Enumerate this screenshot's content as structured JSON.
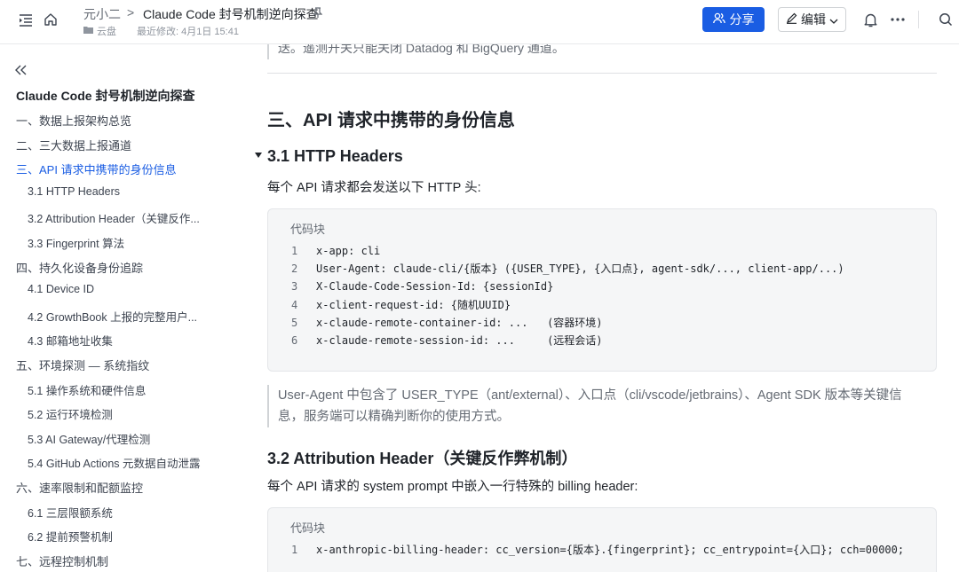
{
  "header": {
    "breadcrumb_parent": "元小二",
    "breadcrumb_sep": ">",
    "title": "Claude Code 封号机制逆向探查",
    "location": "云盘",
    "last_modified": "最近修改: 4月1日 15:41",
    "share_label": "分享",
    "edit_label": "编辑"
  },
  "sidebar": {
    "doc_title": "Claude Code 封号机制逆向探查",
    "items": [
      {
        "label": "一、数据上报架构总览",
        "level": 1
      },
      {
        "label": "二、三大数据上报通道",
        "level": 1
      },
      {
        "label": "三、API 请求中携带的身份信息",
        "level": 1,
        "active": true
      },
      {
        "label": "3.1 HTTP Headers",
        "level": 2
      },
      {
        "label": "3.2 Attribution Header（关键反作...",
        "level": 2
      },
      {
        "label": "3.3 Fingerprint 算法",
        "level": 2
      },
      {
        "label": "四、持久化设备身份追踪",
        "level": 1
      },
      {
        "label": "4.1 Device ID",
        "level": 2
      },
      {
        "label": "4.2 GrowthBook 上报的完整用户...",
        "level": 2
      },
      {
        "label": "4.3 邮箱地址收集",
        "level": 2
      },
      {
        "label": "五、环境探测 — 系统指纹",
        "level": 1
      },
      {
        "label": "5.1 操作系统和硬件信息",
        "level": 2
      },
      {
        "label": "5.2 运行环境检测",
        "level": 2
      },
      {
        "label": "5.3 AI Gateway/代理检测",
        "level": 2
      },
      {
        "label": "5.4 GitHub Actions 元数据自动泄露",
        "level": 2
      },
      {
        "label": "六、速率限制和配额监控",
        "level": 1
      },
      {
        "label": "6.1 三层限额系统",
        "level": 2
      },
      {
        "label": "6.2 提前预警机制",
        "level": 2
      },
      {
        "label": "七、远程控制机制",
        "level": 1
      }
    ]
  },
  "main": {
    "prev_quote": "送。遥测开关只能关闭 Datadog 和 BigQuery 通道。",
    "section_title": "三、API 请求中携带的身份信息",
    "sub1_title": "3.1 HTTP Headers",
    "sub1_intro": "每个 API 请求都会发送以下 HTTP 头:",
    "code1": {
      "label": "代码块",
      "lines": [
        {
          "n": "1",
          "text": "x-app: cli"
        },
        {
          "n": "2",
          "text": "User-Agent: claude-cli/{版本} ({USER_TYPE}, {入口点}, agent-sdk/..., client-app/...)"
        },
        {
          "n": "3",
          "text": "X-Claude-Code-Session-Id: {sessionId}"
        },
        {
          "n": "4",
          "text": "x-client-request-id: {随机UUID}"
        },
        {
          "n": "5",
          "text": "x-claude-remote-container-id: ...   (容器环境)"
        },
        {
          "n": "6",
          "text": "x-claude-remote-session-id: ...     (远程会话)"
        }
      ]
    },
    "quote_line1": "User-Agent 中包含了 USER_TYPE（ant/external）、入口点（cli/vscode/jetbrains）、Agent SDK 版本等关键信",
    "quote_line2": "息，服务端可以精确判断你的使用方式。",
    "sub2_title": "3.2 Attribution Header（关键反作弊机制）",
    "sub2_intro": "每个 API 请求的 system prompt 中嵌入一行特殊的 billing header:",
    "code2": {
      "label": "代码块",
      "lines": [
        {
          "n": "1",
          "text": "x-anthropic-billing-header: cc_version={版本}.{fingerprint}; cc_entrypoint={入口}; cch=00000;"
        }
      ]
    }
  }
}
